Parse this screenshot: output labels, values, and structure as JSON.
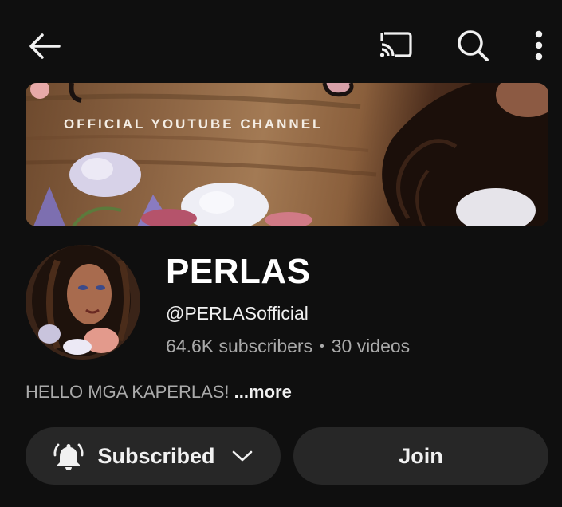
{
  "header": {
    "back_icon": "arrow-left-icon",
    "cast_icon": "cast-icon",
    "search_icon": "search-icon",
    "more_icon": "more-vertical-icon"
  },
  "banner": {
    "text": "OFFICIAL YOUTUBE CHANNEL"
  },
  "channel": {
    "name": "PERLAS",
    "handle": "@PERLASofficial",
    "subscribers": "64.6K subscribers",
    "separator": "•",
    "videos": "30 videos",
    "description": "HELLO MGA KAPERLAS!",
    "more_label": "...more"
  },
  "actions": {
    "subscribed_label": "Subscribed",
    "join_label": "Join",
    "bell_icon": "bell-icon",
    "chevron_icon": "chevron-down-icon"
  },
  "colors": {
    "background": "#0f0f0f",
    "pill": "#272727",
    "secondary_text": "#aaaaaa"
  }
}
